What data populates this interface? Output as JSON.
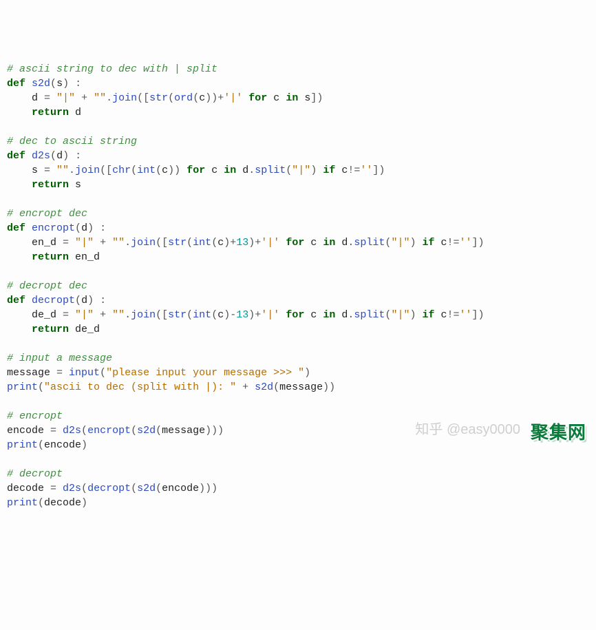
{
  "watermarks": {
    "zhihu": "知乎 @easy0000",
    "site": "聚集网"
  },
  "code": {
    "lines": [
      [
        [
          "c-comment",
          "# ascii string to dec with | split"
        ]
      ],
      [
        [
          "c-kw",
          "def"
        ],
        [
          "c-id",
          " "
        ],
        [
          "c-fn",
          "s2d"
        ],
        [
          "c-op",
          "("
        ],
        [
          "c-id",
          "s"
        ],
        [
          "c-op",
          ") :"
        ]
      ],
      [
        [
          "c-id",
          "    d "
        ],
        [
          "c-op",
          "= "
        ],
        [
          "c-str",
          "\"|\""
        ],
        [
          "c-id",
          " "
        ],
        [
          "c-op",
          "+ "
        ],
        [
          "c-str",
          "\"\""
        ],
        [
          "c-op",
          "."
        ],
        [
          "c-fn",
          "join"
        ],
        [
          "c-op",
          "(["
        ],
        [
          "c-fn",
          "str"
        ],
        [
          "c-op",
          "("
        ],
        [
          "c-fn",
          "ord"
        ],
        [
          "c-op",
          "("
        ],
        [
          "c-id",
          "c"
        ],
        [
          "c-op",
          "))"
        ],
        [
          "c-op",
          "+"
        ],
        [
          "c-str",
          "'|'"
        ],
        [
          "c-id",
          " "
        ],
        [
          "c-kw",
          "for"
        ],
        [
          "c-id",
          " c "
        ],
        [
          "c-kw",
          "in"
        ],
        [
          "c-id",
          " s"
        ],
        [
          "c-op",
          "])"
        ]
      ],
      [
        [
          "c-id",
          "    "
        ],
        [
          "c-kw",
          "return"
        ],
        [
          "c-id",
          " d"
        ]
      ],
      [],
      [
        [
          "c-comment",
          "# dec to ascii string"
        ]
      ],
      [
        [
          "c-kw",
          "def"
        ],
        [
          "c-id",
          " "
        ],
        [
          "c-fn",
          "d2s"
        ],
        [
          "c-op",
          "("
        ],
        [
          "c-id",
          "d"
        ],
        [
          "c-op",
          ") :"
        ]
      ],
      [
        [
          "c-id",
          "    s "
        ],
        [
          "c-op",
          "= "
        ],
        [
          "c-str",
          "\"\""
        ],
        [
          "c-op",
          "."
        ],
        [
          "c-fn",
          "join"
        ],
        [
          "c-op",
          "(["
        ],
        [
          "c-fn",
          "chr"
        ],
        [
          "c-op",
          "("
        ],
        [
          "c-fn",
          "int"
        ],
        [
          "c-op",
          "("
        ],
        [
          "c-id",
          "c"
        ],
        [
          "c-op",
          ")) "
        ],
        [
          "c-kw",
          "for"
        ],
        [
          "c-id",
          " c "
        ],
        [
          "c-kw",
          "in"
        ],
        [
          "c-id",
          " d"
        ],
        [
          "c-op",
          "."
        ],
        [
          "c-fn",
          "split"
        ],
        [
          "c-op",
          "("
        ],
        [
          "c-str",
          "\"|\""
        ],
        [
          "c-op",
          ") "
        ],
        [
          "c-kw",
          "if"
        ],
        [
          "c-id",
          " c"
        ],
        [
          "c-op",
          "!="
        ],
        [
          "c-str",
          "''"
        ],
        [
          "c-op",
          "])"
        ]
      ],
      [
        [
          "c-id",
          "    "
        ],
        [
          "c-kw",
          "return"
        ],
        [
          "c-id",
          " s"
        ]
      ],
      [],
      [
        [
          "c-comment",
          "# encropt dec"
        ]
      ],
      [
        [
          "c-kw",
          "def"
        ],
        [
          "c-id",
          " "
        ],
        [
          "c-fn",
          "encropt"
        ],
        [
          "c-op",
          "("
        ],
        [
          "c-id",
          "d"
        ],
        [
          "c-op",
          ") :"
        ]
      ],
      [
        [
          "c-id",
          "    en_d "
        ],
        [
          "c-op",
          "= "
        ],
        [
          "c-str",
          "\"|\""
        ],
        [
          "c-id",
          " "
        ],
        [
          "c-op",
          "+ "
        ],
        [
          "c-str",
          "\"\""
        ],
        [
          "c-op",
          "."
        ],
        [
          "c-fn",
          "join"
        ],
        [
          "c-op",
          "(["
        ],
        [
          "c-fn",
          "str"
        ],
        [
          "c-op",
          "("
        ],
        [
          "c-fn",
          "int"
        ],
        [
          "c-op",
          "("
        ],
        [
          "c-id",
          "c"
        ],
        [
          "c-op",
          ")"
        ],
        [
          "c-op",
          "+"
        ],
        [
          "c-num",
          "13"
        ],
        [
          "c-op",
          ")"
        ],
        [
          "c-op",
          "+"
        ],
        [
          "c-str",
          "'|'"
        ],
        [
          "c-id",
          " "
        ],
        [
          "c-kw",
          "for"
        ],
        [
          "c-id",
          " c "
        ],
        [
          "c-kw",
          "in"
        ],
        [
          "c-id",
          " d"
        ],
        [
          "c-op",
          "."
        ],
        [
          "c-fn",
          "split"
        ],
        [
          "c-op",
          "("
        ],
        [
          "c-str",
          "\"|\""
        ],
        [
          "c-op",
          ") "
        ],
        [
          "c-kw",
          "if"
        ],
        [
          "c-id",
          " c"
        ],
        [
          "c-op",
          "!="
        ],
        [
          "c-str",
          "''"
        ],
        [
          "c-op",
          "])"
        ]
      ],
      [
        [
          "c-id",
          "    "
        ],
        [
          "c-kw",
          "return"
        ],
        [
          "c-id",
          " en_d"
        ]
      ],
      [],
      [
        [
          "c-comment",
          "# decropt dec"
        ]
      ],
      [
        [
          "c-kw",
          "def"
        ],
        [
          "c-id",
          " "
        ],
        [
          "c-fn",
          "decropt"
        ],
        [
          "c-op",
          "("
        ],
        [
          "c-id",
          "d"
        ],
        [
          "c-op",
          ") :"
        ]
      ],
      [
        [
          "c-id",
          "    de_d "
        ],
        [
          "c-op",
          "= "
        ],
        [
          "c-str",
          "\"|\""
        ],
        [
          "c-id",
          " "
        ],
        [
          "c-op",
          "+ "
        ],
        [
          "c-str",
          "\"\""
        ],
        [
          "c-op",
          "."
        ],
        [
          "c-fn",
          "join"
        ],
        [
          "c-op",
          "(["
        ],
        [
          "c-fn",
          "str"
        ],
        [
          "c-op",
          "("
        ],
        [
          "c-fn",
          "int"
        ],
        [
          "c-op",
          "("
        ],
        [
          "c-id",
          "c"
        ],
        [
          "c-op",
          ")"
        ],
        [
          "c-op",
          "-"
        ],
        [
          "c-num",
          "13"
        ],
        [
          "c-op",
          ")"
        ],
        [
          "c-op",
          "+"
        ],
        [
          "c-str",
          "'|'"
        ],
        [
          "c-id",
          " "
        ],
        [
          "c-kw",
          "for"
        ],
        [
          "c-id",
          " c "
        ],
        [
          "c-kw",
          "in"
        ],
        [
          "c-id",
          " d"
        ],
        [
          "c-op",
          "."
        ],
        [
          "c-fn",
          "split"
        ],
        [
          "c-op",
          "("
        ],
        [
          "c-str",
          "\"|\""
        ],
        [
          "c-op",
          ") "
        ],
        [
          "c-kw",
          "if"
        ],
        [
          "c-id",
          " c"
        ],
        [
          "c-op",
          "!="
        ],
        [
          "c-str",
          "''"
        ],
        [
          "c-op",
          "])"
        ]
      ],
      [
        [
          "c-id",
          "    "
        ],
        [
          "c-kw",
          "return"
        ],
        [
          "c-id",
          " de_d"
        ]
      ],
      [],
      [
        [
          "c-comment",
          "# input a message"
        ]
      ],
      [
        [
          "c-id",
          "message "
        ],
        [
          "c-op",
          "= "
        ],
        [
          "c-fn",
          "input"
        ],
        [
          "c-op",
          "("
        ],
        [
          "c-str",
          "\"please input your message >>> \""
        ],
        [
          "c-op",
          ")"
        ]
      ],
      [
        [
          "c-fn",
          "print"
        ],
        [
          "c-op",
          "("
        ],
        [
          "c-str",
          "\"ascii to dec (split with |): \""
        ],
        [
          "c-id",
          " "
        ],
        [
          "c-op",
          "+ "
        ],
        [
          "c-fn",
          "s2d"
        ],
        [
          "c-op",
          "("
        ],
        [
          "c-id",
          "message"
        ],
        [
          "c-op",
          "))"
        ]
      ],
      [],
      [
        [
          "c-comment",
          "# encropt"
        ]
      ],
      [
        [
          "c-id",
          "encode "
        ],
        [
          "c-op",
          "= "
        ],
        [
          "c-fn",
          "d2s"
        ],
        [
          "c-op",
          "("
        ],
        [
          "c-fn",
          "encropt"
        ],
        [
          "c-op",
          "("
        ],
        [
          "c-fn",
          "s2d"
        ],
        [
          "c-op",
          "("
        ],
        [
          "c-id",
          "message"
        ],
        [
          "c-op",
          ")))"
        ]
      ],
      [
        [
          "c-fn",
          "print"
        ],
        [
          "c-op",
          "("
        ],
        [
          "c-id",
          "encode"
        ],
        [
          "c-op",
          ")"
        ]
      ],
      [],
      [
        [
          "c-comment",
          "# decropt"
        ]
      ],
      [
        [
          "c-id",
          "decode "
        ],
        [
          "c-op",
          "= "
        ],
        [
          "c-fn",
          "d2s"
        ],
        [
          "c-op",
          "("
        ],
        [
          "c-fn",
          "decropt"
        ],
        [
          "c-op",
          "("
        ],
        [
          "c-fn",
          "s2d"
        ],
        [
          "c-op",
          "("
        ],
        [
          "c-id",
          "encode"
        ],
        [
          "c-op",
          ")))"
        ]
      ],
      [
        [
          "c-fn",
          "print"
        ],
        [
          "c-op",
          "("
        ],
        [
          "c-id",
          "decode"
        ],
        [
          "c-op",
          ")"
        ]
      ]
    ]
  }
}
